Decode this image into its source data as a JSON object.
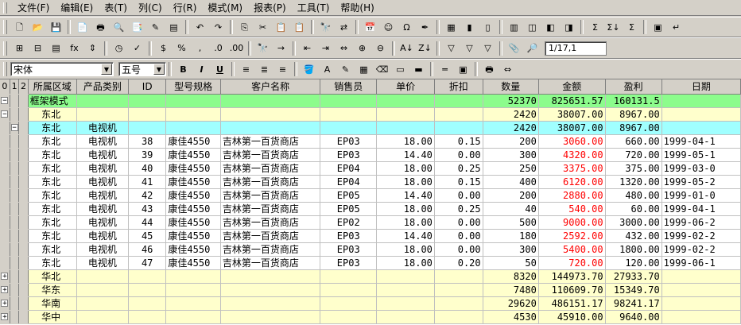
{
  "menu": [
    "文件(F)",
    "编辑(E)",
    "表(T)",
    "列(C)",
    "行(R)",
    "模式(M)",
    "报表(P)",
    "工具(T)",
    "帮助(H)"
  ],
  "toolbar1": {
    "icons": [
      "new-icon",
      "open-icon",
      "save-icon",
      "preview-icon",
      "print-icon",
      "print-preview-icon",
      "find-doc-icon",
      "wizard-icon",
      "database-icon",
      "undo-icon",
      "redo-icon",
      "copy-icon",
      "cut-icon",
      "paste-icon",
      "paste-special-icon",
      "binoculars-icon",
      "replace-icon",
      "calendar-icon",
      "smiley-icon",
      "omega-icon",
      "pen-icon",
      "calculator-icon",
      "bar-chart-icon",
      "column-chart-icon",
      "table-icon",
      "freeze-cols-icon",
      "freeze-rows-icon",
      "unfreeze-icon",
      "sum-icon",
      "subtotal-icon",
      "grand-total-icon",
      "style-icon",
      "return-icon"
    ],
    "glyphs": [
      "🗋",
      "📂",
      "💾",
      "📄",
      "🖶",
      "🔍",
      "📑",
      "✎",
      "▤",
      "↶",
      "↷",
      "⎘",
      "✂",
      "📋",
      "📋",
      "🔭",
      "⇄",
      "📅",
      "☺",
      "Ω",
      "✒",
      "▦",
      "▮",
      "▯",
      "▥",
      "◫",
      "◧",
      "◨",
      "Σ",
      "Σ↓",
      "Σ",
      "▣",
      "↵"
    ]
  },
  "toolbar2": {
    "icons": [
      "insert-row-icon",
      "insert-col-icon",
      "format-icon",
      "function-icon",
      "sort-updown-icon",
      "clock-icon",
      "check-icon",
      "currency-icon",
      "percent-icon",
      "comma-icon",
      "decimal-inc-icon",
      "decimal-dec-icon",
      "find-icon",
      "goto-icon",
      "merge-left-icon",
      "merge-right-icon",
      "split-icon",
      "expand-icon",
      "collapse-icon",
      "sort-asc-icon",
      "sort-desc-icon",
      "filter-icon",
      "filter-clear-icon",
      "filter-remove-icon",
      "attach-icon",
      "zoom-icon"
    ],
    "glyphs": [
      "⊞",
      "⊟",
      "▤",
      "fx",
      "⇕",
      "◷",
      "✓",
      "$",
      "%",
      ",",
      ".0",
      ".00",
      "🔭",
      "→",
      "⇤",
      "⇥",
      "⇔",
      "⊕",
      "⊖",
      "A↓",
      "Z↓",
      "▽",
      "▽",
      "▽",
      "📎",
      "🔎"
    ],
    "page_indicator": "1/17,1"
  },
  "toolbar3": {
    "font_name": "宋体",
    "font_size": "五号",
    "format_buttons": [
      {
        "name": "bold-button",
        "label": "B"
      },
      {
        "name": "italic-button",
        "label": "I"
      },
      {
        "name": "underline-button",
        "label": "U"
      }
    ],
    "icons": [
      "align-left-icon",
      "align-center-icon",
      "align-right-icon",
      "fill-color-icon",
      "font-color-icon",
      "border-draw-icon",
      "grid-lines-icon",
      "eraser-icon",
      "text-box-icon",
      "line-icon",
      "red-line-icon",
      "color-cell-icon",
      "print-setup-icon",
      "column-fit-icon"
    ],
    "glyphs": [
      "≡",
      "≣",
      "≡",
      "🪣",
      "A",
      "✎",
      "▦",
      "⌫",
      "▭",
      "▬",
      "═",
      "▣",
      "🖶",
      "⇔"
    ]
  },
  "outline_levels": [
    "0",
    "1",
    "2"
  ],
  "columns": [
    "所属区域",
    "产品类别",
    "ID",
    "型号规格",
    "客户名称",
    "销售员",
    "单价",
    "折扣",
    "数量",
    "金额",
    "盈利",
    "日期"
  ],
  "rows": [
    {
      "type": "total",
      "outline": "⊟",
      "cells": [
        "框架模式",
        "",
        "",
        "",
        "",
        "",
        "",
        "",
        "52370",
        "825651.57",
        "160131.5",
        ""
      ]
    },
    {
      "type": "region",
      "outline": "⊟",
      "cells": [
        "  东北",
        "",
        "",
        "",
        "",
        "",
        "",
        "",
        "2420",
        "38007.00",
        "8967.00",
        ""
      ]
    },
    {
      "type": "cat",
      "outline": "⊟",
      "cells": [
        "  东北",
        "电视机",
        "",
        "",
        "",
        "",
        "",
        "",
        "2420",
        "38007.00",
        "8967.00",
        ""
      ]
    },
    {
      "type": "data",
      "outline": "",
      "cells": [
        "  东北",
        "电视机",
        "38",
        "康佳4550",
        "吉林第一百货商店",
        "EP03",
        "18.00",
        "0.15",
        "200",
        "3060.00",
        "660.00",
        "1999-04-1"
      ]
    },
    {
      "type": "data",
      "outline": "",
      "cells": [
        "  东北",
        "电视机",
        "39",
        "康佳4550",
        "吉林第一百货商店",
        "EP03",
        "14.40",
        "0.00",
        "300",
        "4320.00",
        "720.00",
        "1999-05-1"
      ]
    },
    {
      "type": "data",
      "outline": "",
      "cells": [
        "  东北",
        "电视机",
        "40",
        "康佳4550",
        "吉林第一百货商店",
        "EP04",
        "18.00",
        "0.25",
        "250",
        "3375.00",
        "375.00",
        "1999-03-0"
      ]
    },
    {
      "type": "data",
      "outline": "",
      "cells": [
        "  东北",
        "电视机",
        "41",
        "康佳4550",
        "吉林第一百货商店",
        "EP04",
        "18.00",
        "0.15",
        "400",
        "6120.00",
        "1320.00",
        "1999-05-2"
      ]
    },
    {
      "type": "data",
      "outline": "",
      "cells": [
        "  东北",
        "电视机",
        "42",
        "康佳4550",
        "吉林第一百货商店",
        "EP05",
        "14.40",
        "0.00",
        "200",
        "2880.00",
        "480.00",
        "1999-01-0"
      ]
    },
    {
      "type": "data",
      "outline": "",
      "cells": [
        "  东北",
        "电视机",
        "43",
        "康佳4550",
        "吉林第一百货商店",
        "EP05",
        "18.00",
        "0.25",
        "40",
        "540.00",
        "60.00",
        "1999-04-1"
      ]
    },
    {
      "type": "data",
      "outline": "",
      "cells": [
        "  东北",
        "电视机",
        "44",
        "康佳4550",
        "吉林第一百货商店",
        "EP02",
        "18.00",
        "0.00",
        "500",
        "9000.00",
        "3000.00",
        "1999-06-2"
      ]
    },
    {
      "type": "data",
      "outline": "",
      "cells": [
        "  东北",
        "电视机",
        "45",
        "康佳4550",
        "吉林第一百货商店",
        "EP03",
        "14.40",
        "0.00",
        "180",
        "2592.00",
        "432.00",
        "1999-02-2"
      ]
    },
    {
      "type": "data",
      "outline": "",
      "cells": [
        "  东北",
        "电视机",
        "46",
        "康佳4550",
        "吉林第一百货商店",
        "EP03",
        "18.00",
        "0.00",
        "300",
        "5400.00",
        "1800.00",
        "1999-02-2"
      ]
    },
    {
      "type": "data",
      "outline": "",
      "cells": [
        "  东北",
        "电视机",
        "47",
        "康佳4550",
        "吉林第一百货商店",
        "EP03",
        "18.00",
        "0.20",
        "50",
        "720.00",
        "120.00",
        "1999-06-1"
      ]
    },
    {
      "type": "region",
      "outline": "⊞",
      "cells": [
        "  华北",
        "",
        "",
        "",
        "",
        "",
        "",
        "",
        "8320",
        "144973.70",
        "27933.70",
        ""
      ]
    },
    {
      "type": "region",
      "outline": "⊞",
      "cells": [
        "  华东",
        "",
        "",
        "",
        "",
        "",
        "",
        "",
        "7480",
        "110609.70",
        "15349.70",
        ""
      ]
    },
    {
      "type": "region",
      "outline": "⊞",
      "cells": [
        "  华南",
        "",
        "",
        "",
        "",
        "",
        "",
        "",
        "29620",
        "486151.17",
        "98241.17",
        ""
      ]
    },
    {
      "type": "region",
      "outline": "⊞",
      "cells": [
        "  华中",
        "",
        "",
        "",
        "",
        "",
        "",
        "",
        "4530",
        "45910.00",
        "9640.00",
        ""
      ]
    }
  ],
  "colors": {
    "total": "#8cfc8c",
    "region": "#ffffcc",
    "category": "#a0ffff",
    "amount_red": "#ff0000"
  }
}
